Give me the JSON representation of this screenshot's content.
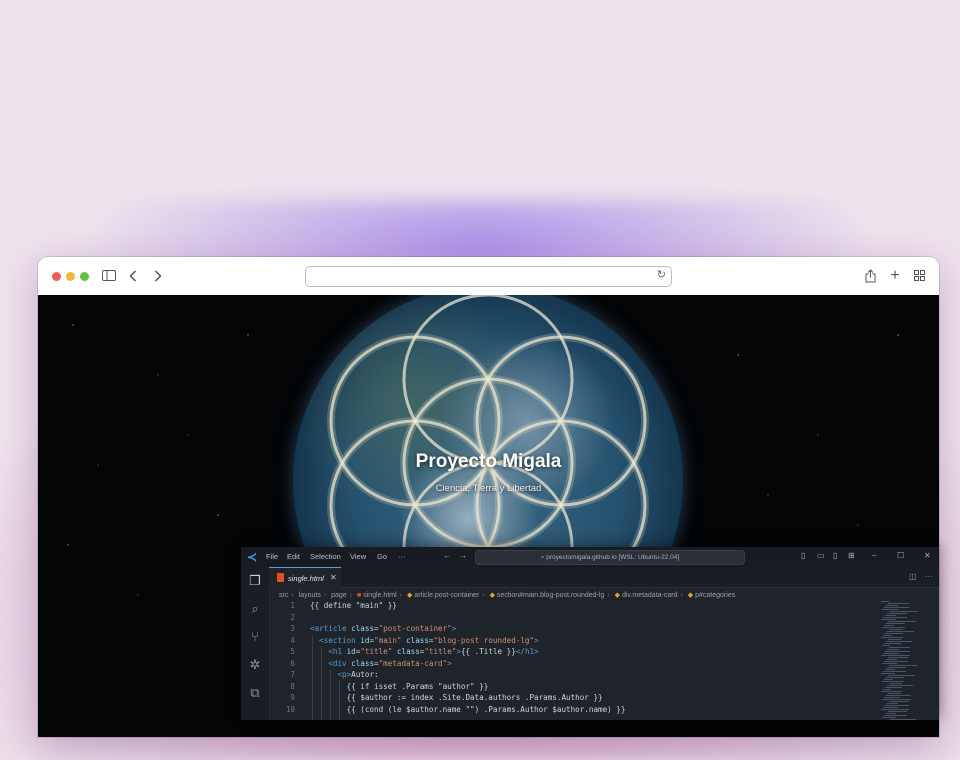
{
  "browser": {
    "url": ""
  },
  "site": {
    "title": "Proyecto Migala",
    "subtitle": "Ciencia, Tierra y Libertad"
  },
  "editor": {
    "menu": [
      "File",
      "Edit",
      "Selection",
      "View",
      "Go",
      "···"
    ],
    "search": "proyectomigala.github.io [WSL: Ubuntu-22.04]",
    "tab": "single.html",
    "breadcrumbs": [
      "src",
      "layouts",
      "page",
      "single.html",
      "article.post-container",
      "section#main.blog-post.rounded-lg",
      "div.metadata-card",
      "p#categories"
    ],
    "line_numbers": [
      "1",
      "2",
      "3",
      "4",
      "5",
      "6",
      "7",
      "8",
      "9",
      "10"
    ],
    "colors": {
      "tag": "#569cd6",
      "attr": "#9cdcfe",
      "string": "#ce9178",
      "accent": "#2f9dea"
    }
  },
  "icons": {
    "sidebar": "sidebar-icon",
    "back": "chevron-left-icon",
    "forward": "chevron-right-icon",
    "reload": "reload-icon",
    "share": "share-icon",
    "new_tab": "plus-icon",
    "tabs": "tab-overview-icon",
    "explorer": "files-icon",
    "search": "search-icon",
    "scm": "source-control-icon",
    "debug": "bug-icon",
    "extensions": "extensions-icon"
  }
}
